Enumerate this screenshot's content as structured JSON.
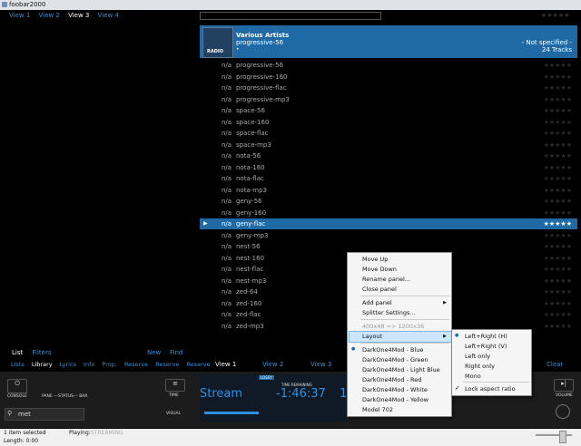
{
  "window": {
    "title": "foobar2000"
  },
  "topnav": [
    "View 1",
    "View 2",
    "View 3",
    "View 4"
  ],
  "active_view": "View 3",
  "album": {
    "artist": "Various Artists",
    "name": "progressive-56",
    "dot": "•",
    "genre": "- Not specified -",
    "tracks": "24 Tracks",
    "cover": "RADIO"
  },
  "stars": "★★★★★",
  "tracks": [
    {
      "n": "n/a",
      "name": "progressive-56"
    },
    {
      "n": "n/a",
      "name": "progressive-160"
    },
    {
      "n": "n/a",
      "name": "progressive-flac"
    },
    {
      "n": "n/a",
      "name": "progressive-mp3"
    },
    {
      "n": "n/a",
      "name": "space-56"
    },
    {
      "n": "n/a",
      "name": "space-160"
    },
    {
      "n": "n/a",
      "name": "space-flac"
    },
    {
      "n": "n/a",
      "name": "space-mp3"
    },
    {
      "n": "n/a",
      "name": "nota-56"
    },
    {
      "n": "n/a",
      "name": "nota-160"
    },
    {
      "n": "n/a",
      "name": "nota-flac"
    },
    {
      "n": "n/a",
      "name": "nota-mp3"
    },
    {
      "n": "n/a",
      "name": "geny-56"
    },
    {
      "n": "n/a",
      "name": "geny-160"
    },
    {
      "n": "n/a",
      "name": "geny-flac",
      "selected": true
    },
    {
      "n": "n/a",
      "name": "geny-mp3"
    },
    {
      "n": "n/a",
      "name": "nest-56"
    },
    {
      "n": "n/a",
      "name": "nest-160"
    },
    {
      "n": "n/a",
      "name": "nest-flac"
    },
    {
      "n": "n/a",
      "name": "nest-mp3"
    },
    {
      "n": "n/a",
      "name": "zed-64"
    },
    {
      "n": "n/a",
      "name": "zed-160"
    },
    {
      "n": "n/a",
      "name": "zed-flac"
    },
    {
      "n": "n/a",
      "name": "zed-mp3"
    }
  ],
  "left_tabs1": {
    "list": "List",
    "filters": "Filters",
    "new": "New",
    "find": "Find"
  },
  "left_tabs2": [
    "Lists",
    "Library",
    "Lyrics",
    "Info",
    "Prop.",
    "Reserve",
    "Reserve",
    "Reserve"
  ],
  "bottom_views": {
    "v1": "View 1",
    "v2": "View 2",
    "v3": "View 3",
    "clear": "Clear"
  },
  "controls": {
    "console": "CONSOLE",
    "panel": "PANE ---STATUS--- BAR",
    "time": "TIME",
    "visual": "VISUAL",
    "volume": "VOLUME",
    "lossy": "LOSSY",
    "time_remaining": "TIME REMAINING",
    "stream": "Stream",
    "remaining": "-1:46:37",
    "extra": "1",
    "search": "met"
  },
  "context_menu": {
    "items": [
      "Move Up",
      "Move Down",
      "Rename panel...",
      "Close panel",
      "Add panel",
      "Splitter Settings...",
      "400x48 => 1200x36",
      "Layout",
      "DarkOne4Mod - Blue",
      "DarkOne4Mod - Green",
      "DarkOne4Mod - Light Blue",
      "DarkOne4Mod - Red",
      "DarkOne4Mod - White",
      "DarkOne4Mod - Yellow",
      "Model 702"
    ]
  },
  "layout_menu": {
    "items": [
      "Left+Right (H)",
      "Left+Right (V)",
      "Left only",
      "Right only",
      "Mono",
      "Lock aspect ratio"
    ]
  },
  "status": {
    "selected": "1 item selected",
    "length": "Length: 0:00",
    "playing_label": "Playing:",
    "playing_value": "STREAMING"
  }
}
